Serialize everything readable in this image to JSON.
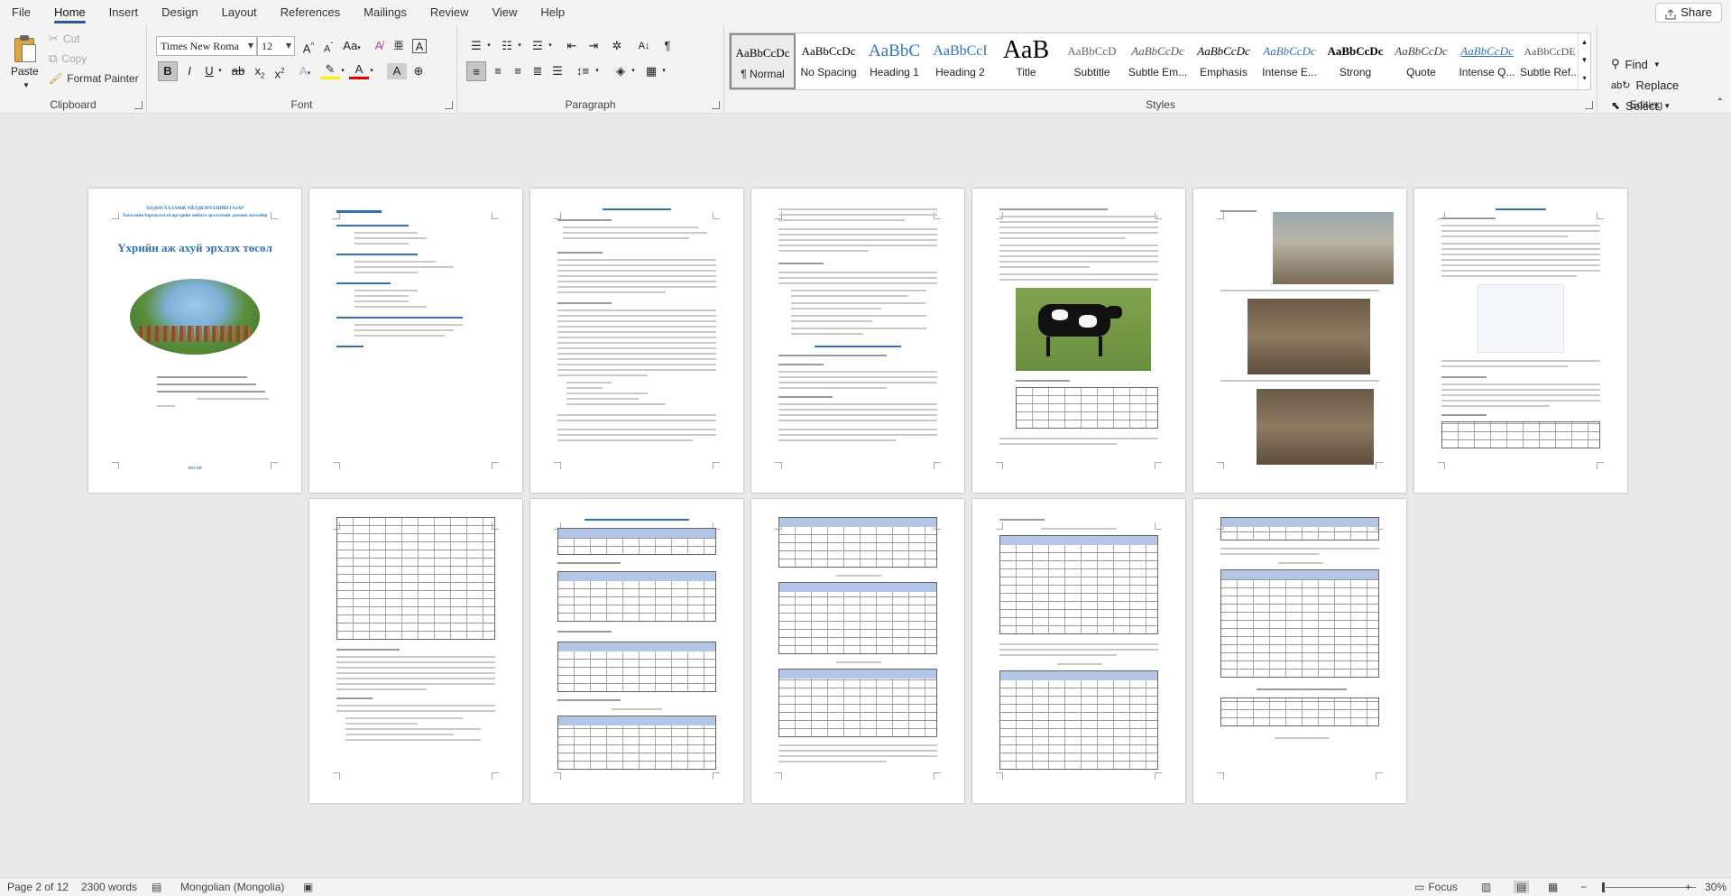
{
  "tabs": [
    "File",
    "Home",
    "Insert",
    "Design",
    "Layout",
    "References",
    "Mailings",
    "Review",
    "View",
    "Help"
  ],
  "active_tab": "Home",
  "share_label": "Share",
  "clipboard": {
    "paste_label": "Paste",
    "cut_label": "Cut",
    "copy_label": "Copy",
    "format_painter_label": "Format Painter",
    "group_label": "Clipboard"
  },
  "font": {
    "font_name": "Times New Roma",
    "font_size": "12",
    "group_label": "Font"
  },
  "paragraph": {
    "group_label": "Paragraph"
  },
  "styles": {
    "group_label": "Styles",
    "items": [
      {
        "preview": "AaBbCcDc",
        "name": "¶ Normal"
      },
      {
        "preview": "AaBbCcDc",
        "name": "No Spacing"
      },
      {
        "preview": "AaBbC",
        "name": "Heading 1"
      },
      {
        "preview": "AaBbCcI",
        "name": "Heading 2"
      },
      {
        "preview": "AaB",
        "name": "Title"
      },
      {
        "preview": "AaBbCcD",
        "name": "Subtitle"
      },
      {
        "preview": "AaBbCcDc",
        "name": "Subtle Em..."
      },
      {
        "preview": "AaBbCcDc",
        "name": "Emphasis"
      },
      {
        "preview": "AaBbCcDc",
        "name": "Intense E..."
      },
      {
        "preview": "AaBbCcDc",
        "name": "Strong"
      },
      {
        "preview": "AaBbCcDc",
        "name": "Quote"
      },
      {
        "preview": "AaBbCcDc",
        "name": "Intense Q..."
      },
      {
        "preview": "AaBbCcDE",
        "name": "Subtle Ref..."
      }
    ]
  },
  "editing": {
    "find_label": "Find",
    "replace_label": "Replace",
    "select_label": "Select",
    "group_label": "Editing"
  },
  "cover": {
    "line1": "ХӨДӨӨ ХАЛАМЖ ҮЙЛДВЭРЛЭЛИЙН ГАЗАР",
    "line2": "Хөгжлийн бэрхшээлтэй иргэдийн хиймэл эрхлэлтийг дэмжих хөтөлбөр",
    "title": "Үхрийн аж ахуй эрхлэх төсөл",
    "footer": "2023 ОН"
  },
  "status": {
    "page": "Page 2 of 12",
    "words": "2300 words",
    "language": "Mongolian (Mongolia)",
    "focus_label": "Focus",
    "zoom": "30%"
  }
}
